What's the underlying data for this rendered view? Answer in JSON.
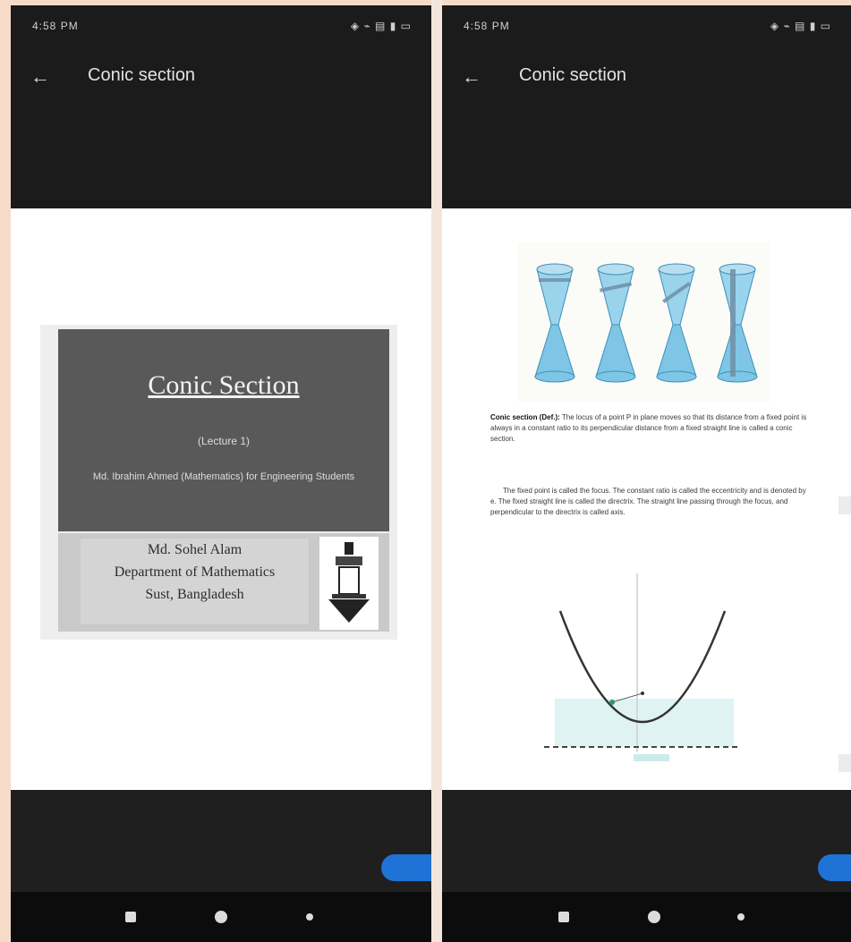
{
  "screens": [
    {
      "status": {
        "time": "4:58 PM",
        "icons": "◈ ⌁ ▤ ▮ ▭"
      },
      "appbar": {
        "title": "Conic section"
      },
      "slide": {
        "title": "Conic Section",
        "subtitle": "(Lecture 1)",
        "description": "Md. Ibrahim Ahmed (Mathematics) for Engineering Students",
        "author_lines": [
          "Md. Sohel Alam",
          "Department of Mathematics",
          "Sust, Bangladesh"
        ]
      }
    },
    {
      "status": {
        "time": "4:58 PM",
        "icons": "◈ ⌁ ▤ ▮ ▭"
      },
      "appbar": {
        "title": "Conic section"
      },
      "paragraphs": [
        {
          "lead": "Conic section (Def.):",
          "text": "The locus of a point P in plane moves so that its distance from a fixed point is always in a constant ratio to its perpendicular distance from a fixed straight line is called a conic section."
        },
        {
          "lead": "",
          "text": "The fixed point is called the focus. The constant ratio is called the eccentricity and is denoted by e. The fixed straight line is called the directrix. The straight line passing through the focus, and perpendicular to the directrix is called axis."
        }
      ]
    }
  ],
  "colors": {
    "background": "#f6dcc8",
    "topbar": "#1b1b1b",
    "bottombar": "#1f1f1f",
    "navbar": "#0c0c0c",
    "fab": "#1f73d6",
    "slide_head": "#595959",
    "slide_foot": "#c9c9c9"
  },
  "icons": [
    "back-arrow-icon",
    "recent-apps-icon",
    "home-icon",
    "back-nav-icon"
  ]
}
